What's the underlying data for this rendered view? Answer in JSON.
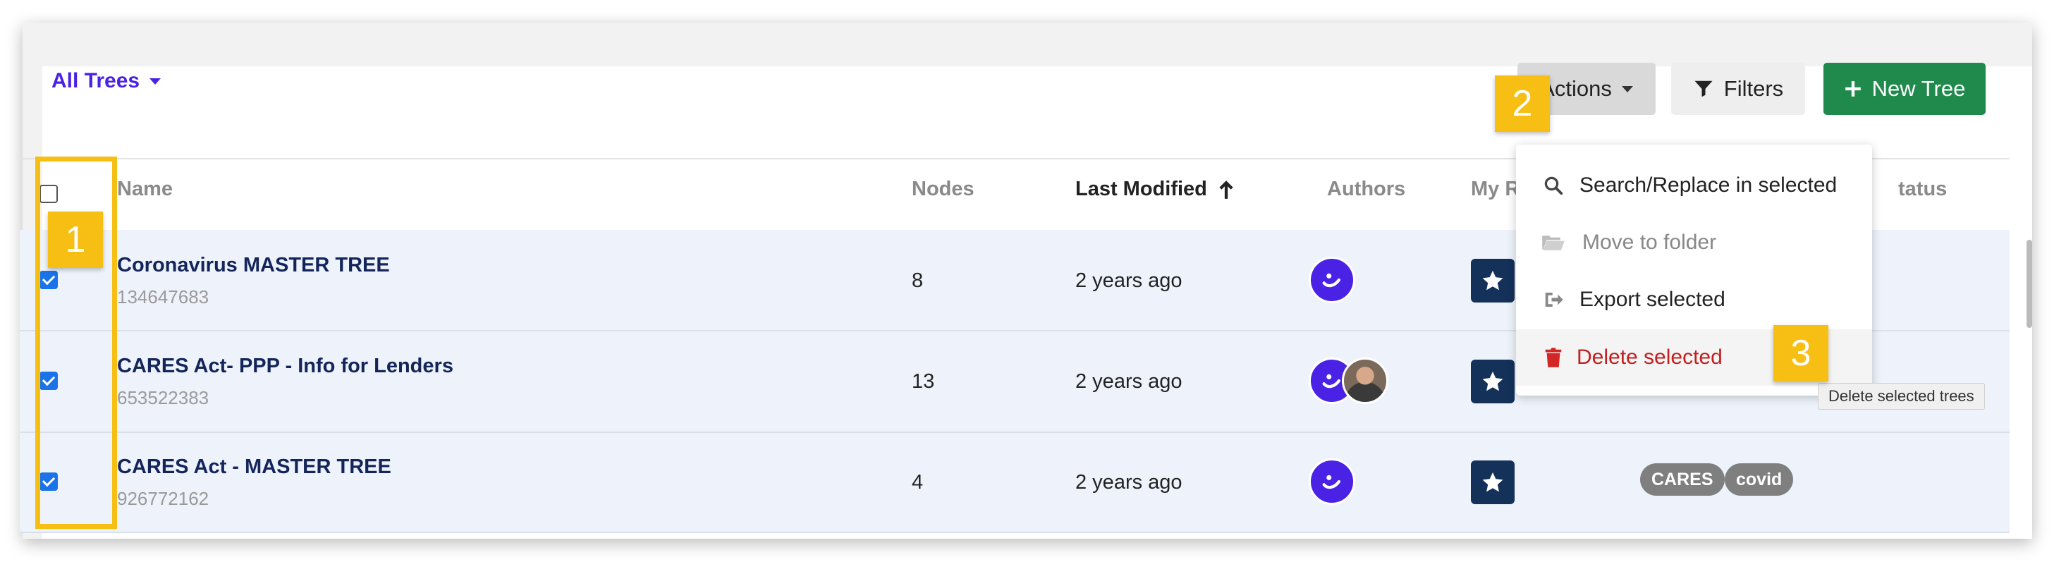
{
  "toolbar": {
    "all_trees_label": "All Trees",
    "actions_label": "Actions",
    "filters_label": "Filters",
    "new_tree_label": "New Tree"
  },
  "table": {
    "columns": {
      "name": "Name",
      "nodes": "Nodes",
      "last_modified": "Last Modified",
      "authors": "Authors",
      "my_rights": "My Rig",
      "status": "tatus"
    },
    "rows": [
      {
        "name": "Coronavirus MASTER TREE",
        "id": "134647683",
        "nodes": "8",
        "last_modified": "2 years ago",
        "checked": true,
        "tags": []
      },
      {
        "name": "CARES Act- PPP - Info for Lenders",
        "id": "653522383",
        "nodes": "13",
        "last_modified": "2 years ago",
        "checked": true,
        "tags": []
      },
      {
        "name": "CARES Act - MASTER TREE",
        "id": "926772162",
        "nodes": "4",
        "last_modified": "2 years ago",
        "checked": true,
        "tags": [
          "CARES",
          "covid"
        ]
      }
    ]
  },
  "actions_menu": {
    "items": [
      {
        "label": "Search/Replace in selected",
        "icon": "search-icon"
      },
      {
        "label": "Move to folder",
        "icon": "folder-open-icon",
        "disabled": true
      },
      {
        "label": "Export selected",
        "icon": "export-icon"
      },
      {
        "label": "Delete selected",
        "icon": "trash-icon",
        "danger": true
      }
    ],
    "tooltip": "Delete selected trees"
  },
  "annotations": [
    "1",
    "2",
    "3"
  ],
  "colors": {
    "accent": "#4a22e6",
    "new_tree_button": "#1f8a4c",
    "danger": "#c21f1f",
    "annotation": "#f7bf13",
    "row_selected": "#eef3fb",
    "rights_badge": "#14315a"
  }
}
